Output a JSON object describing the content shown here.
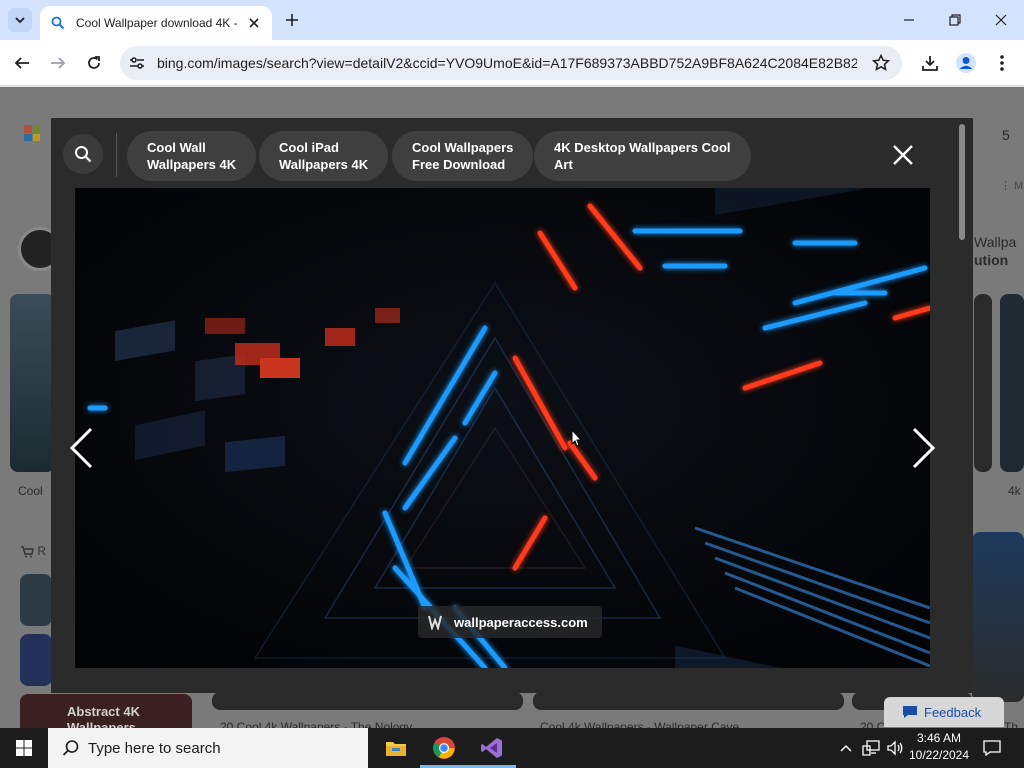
{
  "browser": {
    "tab_title": "Cool Wallpaper download 4K -",
    "url": "bing.com/images/search?view=detailV2&ccid=YVO9UmoE&id=A17F689373ABBD752A9BF8A624C2084E82B82..."
  },
  "background_page": {
    "count_fragment": "5",
    "menu_fragment": "⋮ M",
    "side_text_1": "Wallpa",
    "side_text_2": "ution",
    "left_caption": "Cool",
    "right_caption": "4k",
    "section_icon_label": "R",
    "abstract_caption": "Abstract 4K Wallpapers",
    "bottom_caption_1": "20 Cool 4k Wallpapers - The Nology",
    "bottom_caption_2": "Cool 4k Wallpapers - Wallpaper Cave",
    "bottom_caption_3": "20 C",
    "bottom_caption_4": "Th"
  },
  "modal": {
    "related_searches": [
      {
        "line1": "Cool Wall",
        "line2": "Wallpapers 4K"
      },
      {
        "line1": "Cool iPad",
        "line2": "Wallpapers 4K"
      },
      {
        "line1": "Cool Wallpapers",
        "line2": "Free Download"
      },
      {
        "line1": "4K Desktop Wallpapers Cool",
        "line2": "Art"
      }
    ],
    "source_label": "wallpaperaccess.com"
  },
  "feedback_label": "Feedback",
  "taskbar": {
    "search_placeholder": "Type here to search",
    "time": "3:46 AM",
    "date": "10/22/2024"
  },
  "colors": {
    "neon_blue": "#1e9bff",
    "neon_red": "#ff3b1f",
    "chrome_tab_bg": "#d3e3fd",
    "taskbar_accent": "#76b9ed"
  },
  "icons": [
    "tab-list-icon",
    "bing-search-icon",
    "close-icon",
    "plus-icon",
    "minimize-icon",
    "maximize-icon",
    "back-icon",
    "forward-icon",
    "reload-icon",
    "site-settings-icon",
    "star-icon",
    "download-icon",
    "profile-icon",
    "more-icon",
    "search-icon",
    "chevron-left-icon",
    "chevron-right-icon",
    "windows-icon",
    "file-explorer-icon",
    "chrome-icon",
    "visual-studio-icon",
    "chevron-up-icon",
    "network-icon",
    "volume-icon",
    "notification-icon"
  ]
}
